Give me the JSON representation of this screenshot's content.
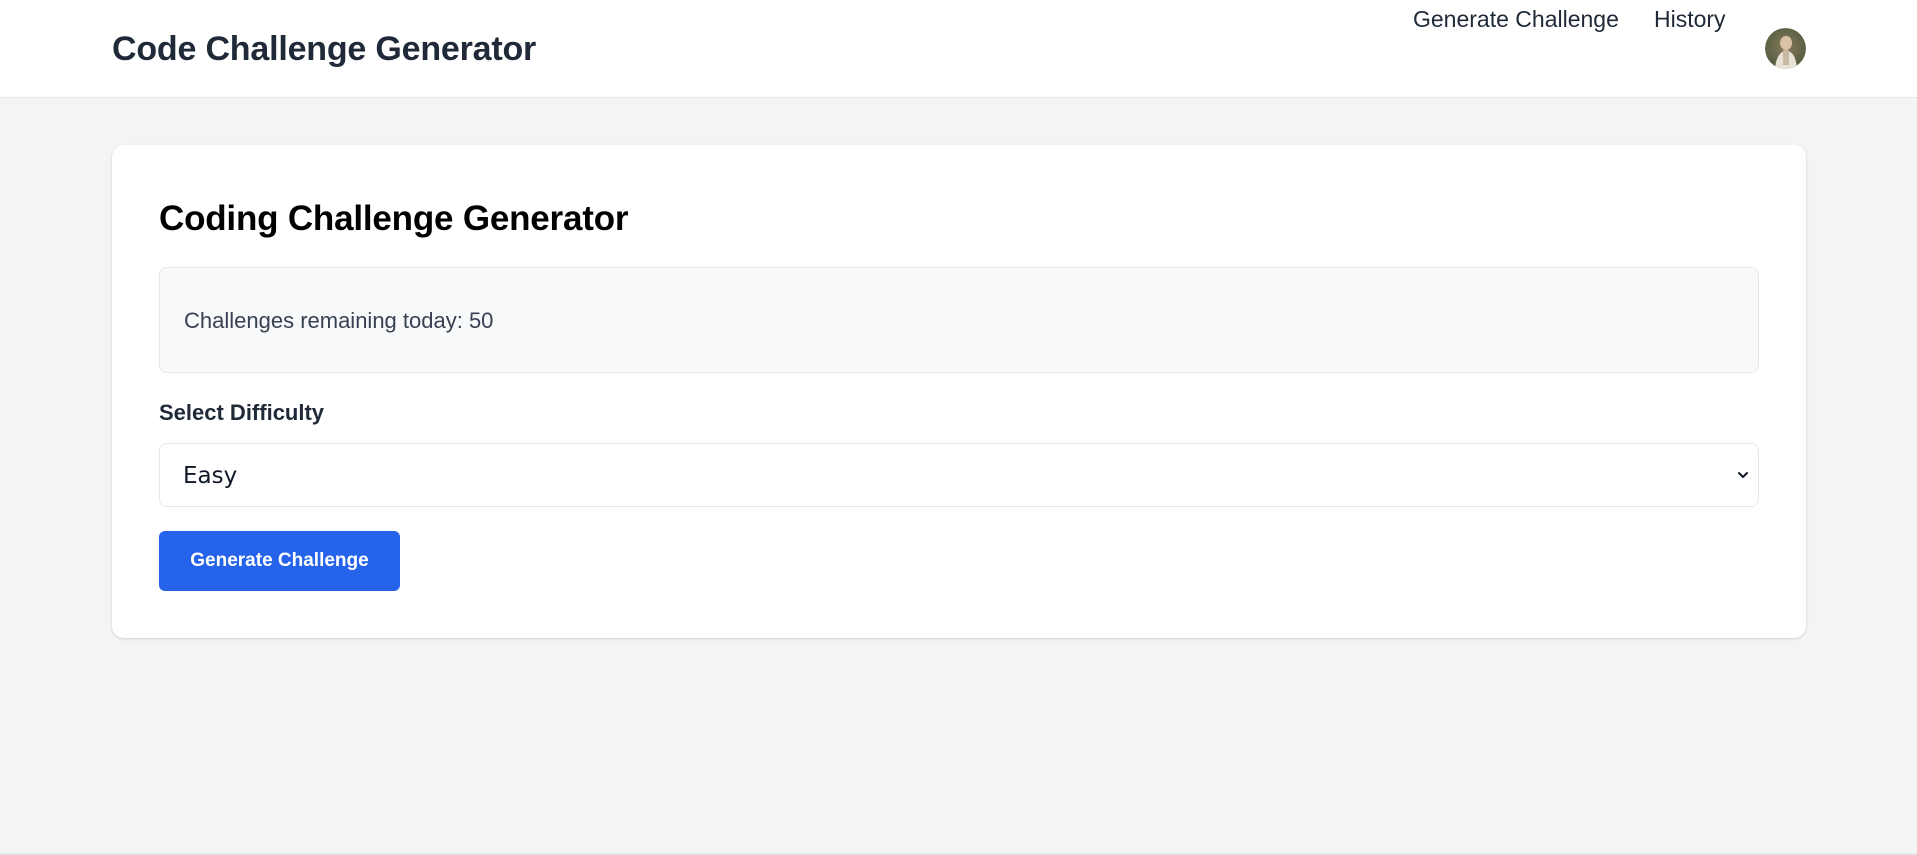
{
  "header": {
    "title": "Code Challenge Generator",
    "nav": {
      "generate_label": "Generate Challenge",
      "history_label": "History"
    },
    "avatar_icon": "user-avatar"
  },
  "main": {
    "title": "Coding Challenge Generator",
    "remaining_text": "Challenges remaining today: 50",
    "difficulty": {
      "label": "Select Difficulty",
      "selected": "Easy",
      "chevron_icon": "chevron-down-icon"
    },
    "generate_button_label": "Generate Challenge"
  },
  "colors": {
    "primary": "#2563eb",
    "page_background": "#f3f4f6",
    "card_background": "#ffffff",
    "text_dark": "#1f2937"
  }
}
